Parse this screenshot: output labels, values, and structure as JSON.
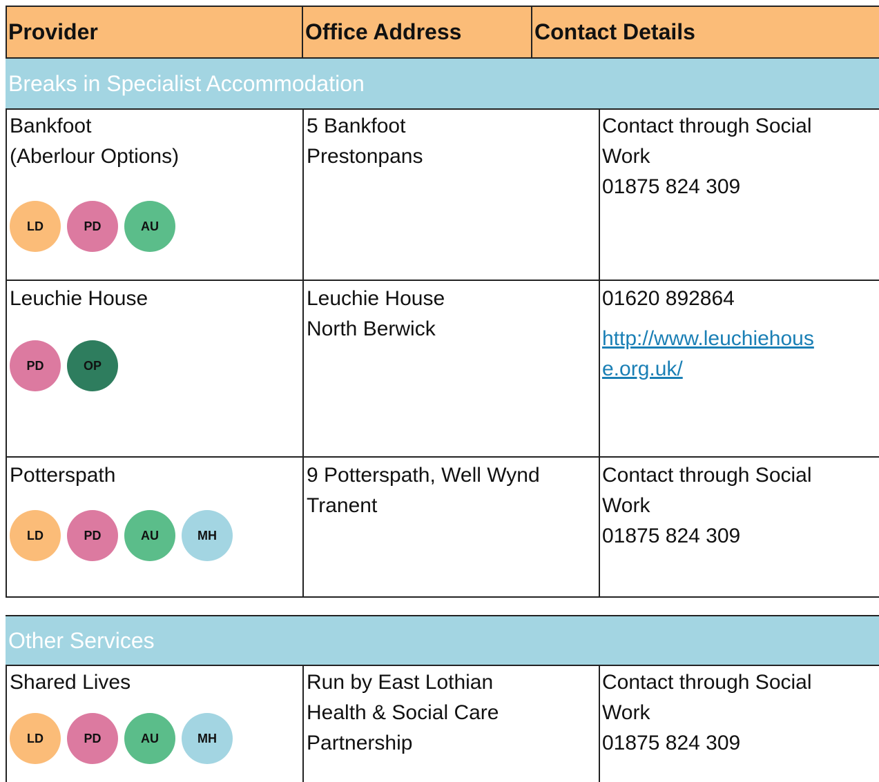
{
  "header": {
    "provider": "Provider",
    "office_address": "Office Address",
    "contact_details": "Contact Details"
  },
  "section1": {
    "title": "Breaks in Specialist Accommodation",
    "rows": [
      {
        "provider_lines": [
          "Bankfoot",
          "(Aberlour Options)"
        ],
        "badges": [
          "LD",
          "PD",
          "AU"
        ],
        "address_lines": [
          "5 Bankfoot",
          "Prestonpans"
        ],
        "contact_lines": [
          "Contact through Social",
          "Work",
          "01875 824 309"
        ]
      },
      {
        "provider_lines": [
          "Leuchie House"
        ],
        "badges": [
          "PD",
          "OP"
        ],
        "address_lines": [
          "Leuchie House",
          "North Berwick"
        ],
        "contact_lines": [
          "01620 892864"
        ],
        "link_lines": [
          " http://www.leuchiehous",
          "e.org.uk/"
        ]
      },
      {
        "provider_lines": [
          "Potterspath"
        ],
        "badges": [
          "LD",
          "PD",
          "AU",
          "MH"
        ],
        "address_lines": [
          "9 Potterspath, Well Wynd",
          "Tranent"
        ],
        "contact_lines": [
          "Contact through Social",
          "Work",
          "01875 824 309"
        ]
      }
    ]
  },
  "section2": {
    "title": "Other Services",
    "rows": [
      {
        "provider_lines": [
          "Shared Lives"
        ],
        "badges": [
          "LD",
          "PD",
          "AU",
          "MH"
        ],
        "address_lines": [
          "Run by East Lothian",
          "Health & Social Care",
          "Partnership"
        ],
        "contact_lines": [
          "Contact through Social",
          "Work",
          "01875 824 309"
        ]
      }
    ]
  },
  "colors": {
    "header_bg": "#fbbc78",
    "band_bg": "#a3d5e2",
    "LD": "#fbbc78",
    "PD": "#dc7aa0",
    "AU": "#5bbd8a",
    "MH": "#a3d5e2",
    "OP": "#2e7d5e",
    "link": "#1a7fb5"
  }
}
